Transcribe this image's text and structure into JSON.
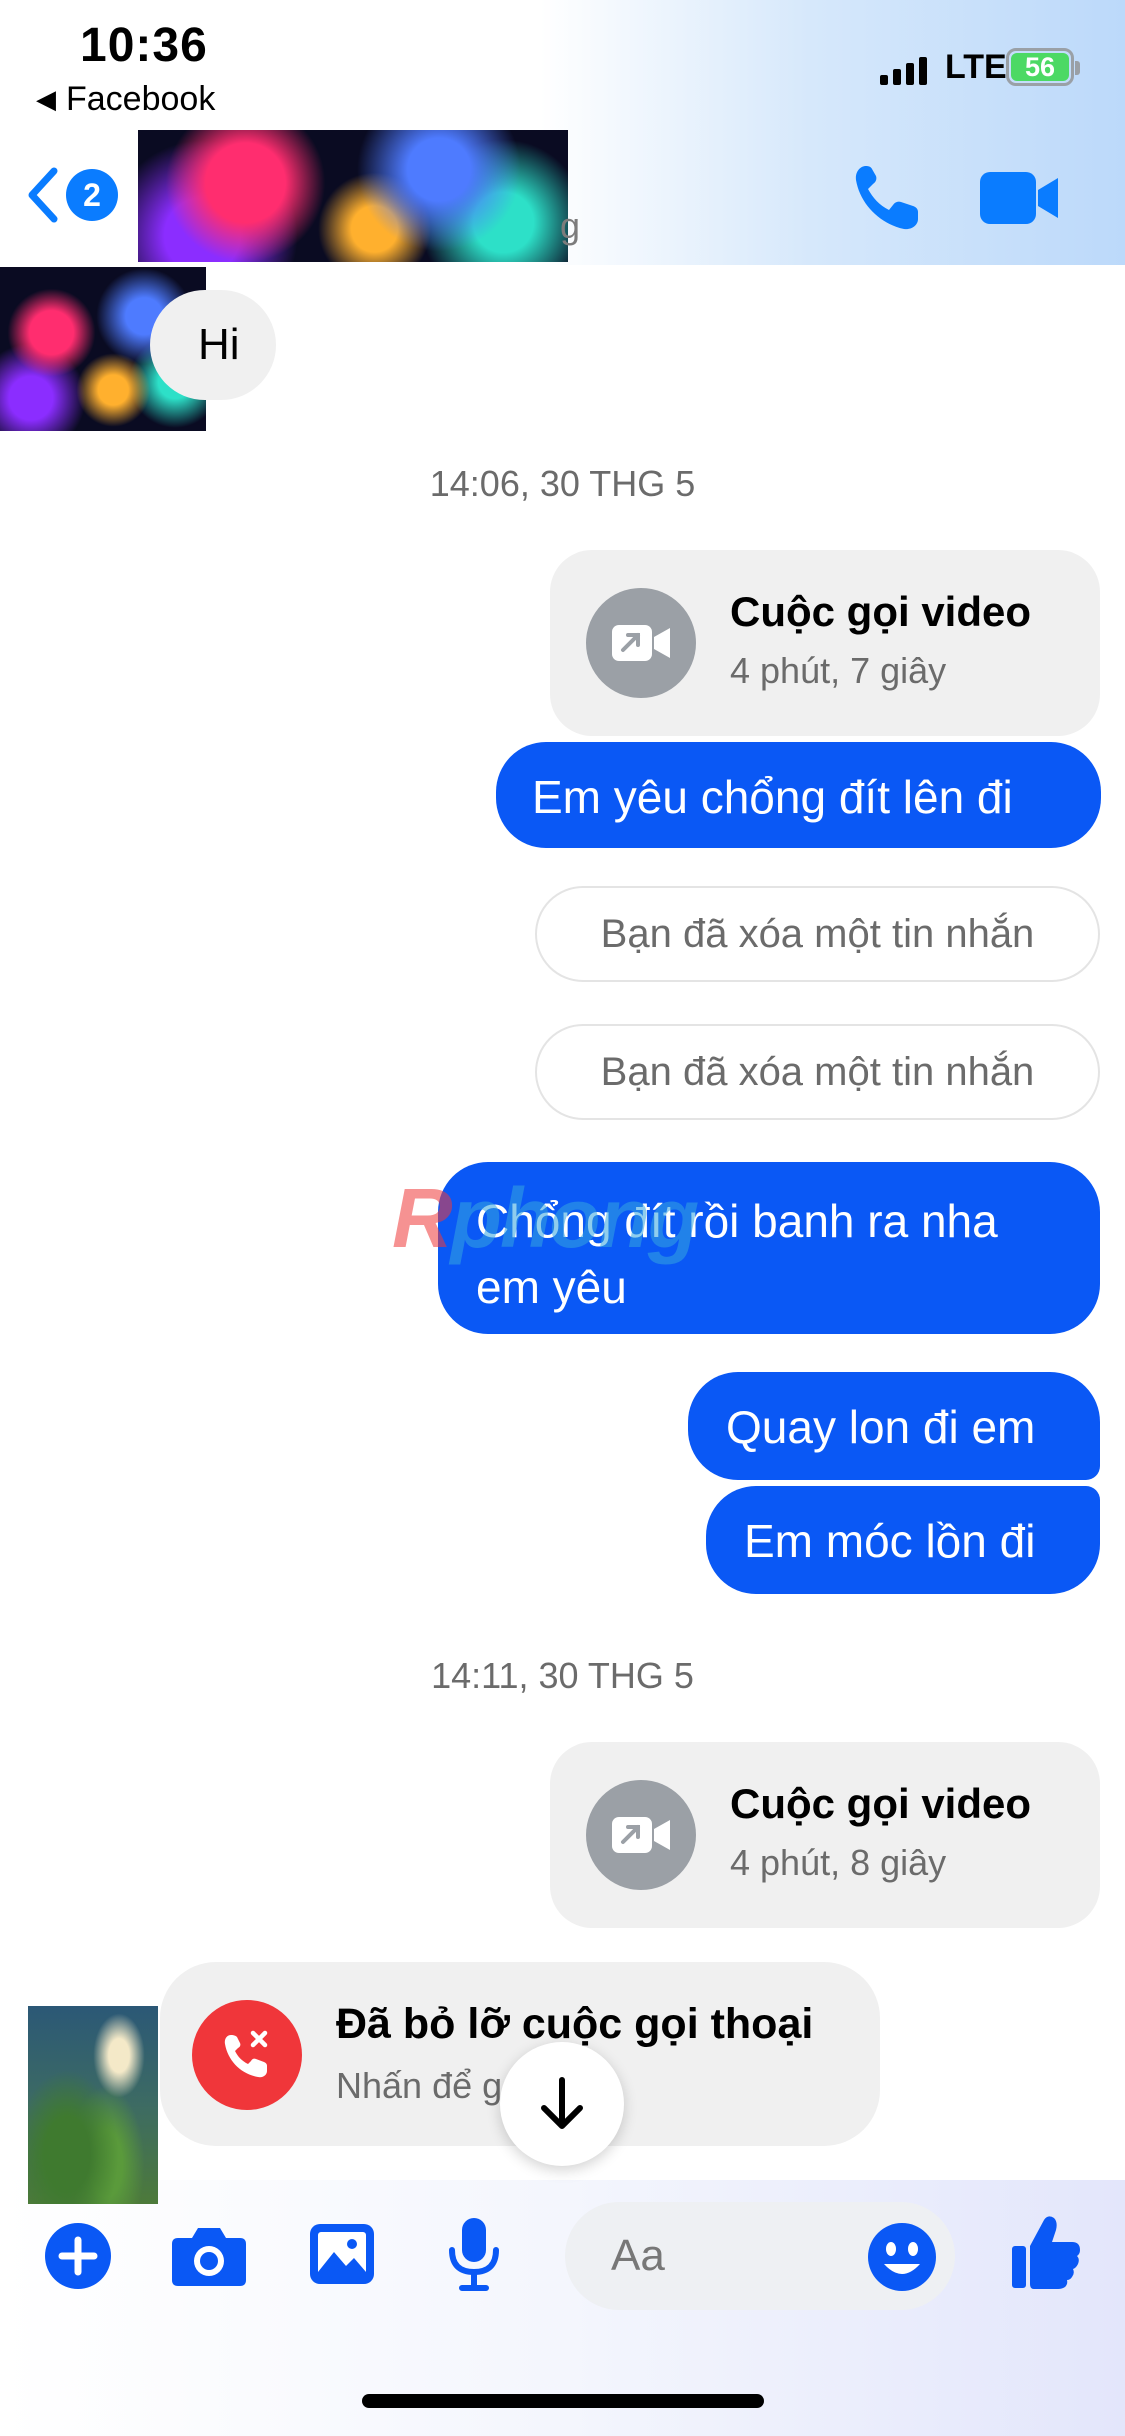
{
  "status_bar": {
    "time": "10:36",
    "back_app": "Facebook",
    "network": "LTE",
    "battery": "56"
  },
  "header": {
    "unread_count": "2",
    "name_fragment": "g"
  },
  "messages": {
    "hi": "Hi",
    "timestamp_1": "14:06, 30 THG 5",
    "call_1_title": "Cuộc gọi video",
    "call_1_duration": "4 phút, 7 giây",
    "sent_1": "Em yêu chổng đít lên đi",
    "deleted_1": "Bạn đã xóa một tin nhắn",
    "deleted_2": "Bạn đã xóa một tin nhắn",
    "sent_2_line1": "Chổng đít rồi banh ra nha",
    "sent_2_line2": "em yêu",
    "sent_3": "Quay lon đi em",
    "sent_4": "Em móc lồn đi",
    "timestamp_2": "14:11, 30 THG 5",
    "call_2_title": "Cuộc gọi video",
    "call_2_duration": "4 phút, 8 giây",
    "missed_title": "Đã bỏ lỡ cuộc gọi thoại",
    "missed_sub": "Nhấn để gọi lại"
  },
  "watermark": {
    "part1": "R",
    "part2": "phong"
  },
  "composer": {
    "placeholder": "Aa"
  },
  "colors": {
    "messenger_blue": "#0a58f5",
    "accent_blue": "#0a7cff",
    "missed_red": "#f0363a",
    "bubble_gray": "#f0f0f0"
  },
  "icons": [
    "chevron-left-icon",
    "phone-icon",
    "video-camera-icon",
    "video-call-icon",
    "missed-call-icon",
    "arrow-down-icon",
    "plus-icon",
    "camera-icon",
    "image-icon",
    "microphone-icon",
    "emoji-icon",
    "thumbs-up-icon"
  ]
}
